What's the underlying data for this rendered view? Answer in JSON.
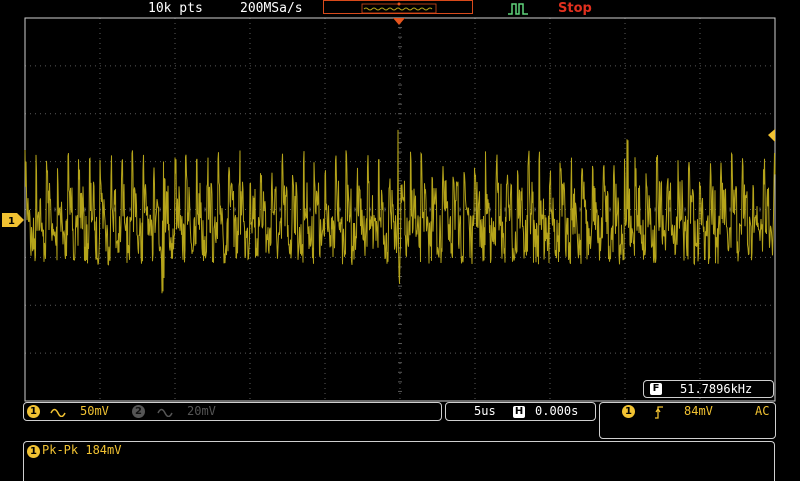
{
  "topbar": {
    "record_length": "10k pts",
    "sample_rate": "200MSa/s",
    "run_state": "Stop"
  },
  "channel1": {
    "marker_label": "1",
    "scale": "50mV",
    "coupling_icon": "ac-wave-icon",
    "color": "#b5a41a"
  },
  "channel2": {
    "marker_label": "2",
    "scale": "20mV",
    "coupling_icon": "ac-wave-icon"
  },
  "timebase": {
    "scale": "5us",
    "position_icon": "H",
    "position": "0.000s"
  },
  "trigger": {
    "source": "1",
    "slope_icon": "rising-edge-icon",
    "level": "84mV",
    "coupling": "AC"
  },
  "frequency": {
    "icon": "F",
    "value": "51.7896kHz"
  },
  "measurement": {
    "channel": "1",
    "label": "Pk-Pk 184mV"
  }
}
